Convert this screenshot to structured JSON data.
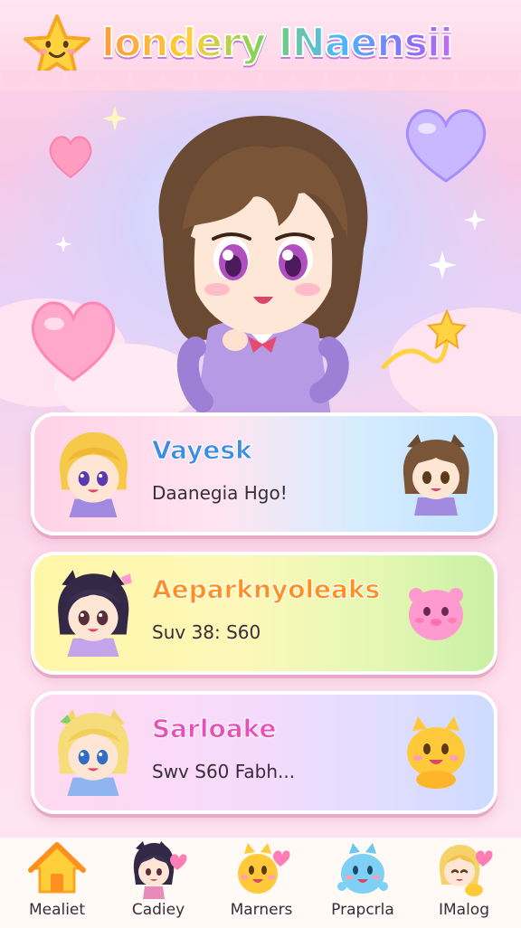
{
  "app": {
    "title": "londery INaensii"
  },
  "colors": {
    "accent_pink": "#ff6fd0",
    "card1_title": "#3b8ee6",
    "card2_title": "#ff8f1f",
    "card3_title": "#e650b8"
  },
  "hero": {
    "character_icon": "chibi-girl-brown-hair"
  },
  "cards": [
    {
      "title": "Vayesk",
      "subtitle": "Daanegia Hgo!",
      "avatar_icon": "chibi-blonde-boy",
      "right_icon": "chibi-brown-hair-cat-ears"
    },
    {
      "title": "Aeparknyoleaks",
      "subtitle": "Suv 38: S60",
      "avatar_icon": "chibi-dark-hair-cat-ears",
      "right_icon": "pink-blob-creature"
    },
    {
      "title": "Sarloake",
      "subtitle": "Swv S60 Fabh...",
      "avatar_icon": "chibi-blonde-cat-ears",
      "right_icon": "yellow-cat-creature"
    }
  ],
  "nav": [
    {
      "label": "Mealiet",
      "icon": "home-icon"
    },
    {
      "label": "Cadiey",
      "icon": "chibi-girl-heart"
    },
    {
      "label": "Marners",
      "icon": "yellow-creature-heart"
    },
    {
      "label": "Prapcrla",
      "icon": "blue-creature"
    },
    {
      "label": "IMalog",
      "icon": "blonde-chibi-heart"
    }
  ]
}
